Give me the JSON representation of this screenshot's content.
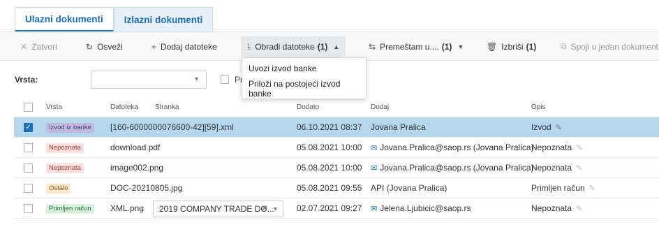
{
  "tabs": [
    {
      "label": "Ulazni dokumenti",
      "active": true
    },
    {
      "label": "Izlazni dokumenti",
      "active": false
    }
  ],
  "toolbar": {
    "close": {
      "icon": "close-icon",
      "label": "Zatvori"
    },
    "refresh": {
      "icon": "refresh-icon",
      "label": "Osveži"
    },
    "add": {
      "icon": "plus-icon",
      "label": "Dodaj datoteke"
    },
    "process": {
      "icon": "download-icon",
      "label": "Obradi datoteke",
      "count": "(1)"
    },
    "move": {
      "icon": "move-icon",
      "label": "Premeštam u....",
      "count": "(1)"
    },
    "delete": {
      "icon": "trash-icon",
      "label": "Izbriši",
      "count": "(1)"
    },
    "merge": {
      "icon": "merge-icon",
      "label": "Spoji u jedan dokument"
    }
  },
  "dropdown": {
    "items": [
      "Uvozi izvod banke",
      "Priloži na postojeći izvod banke"
    ]
  },
  "filter": {
    "label": "Vrsta:",
    "select_value": "",
    "checkbox_label": "Pr"
  },
  "table": {
    "headers": {
      "vrsta": "Vrsta",
      "datoteka": "Datoteka",
      "stranka": "Stranka",
      "dodato": "Dodato",
      "dodaj": "Dodaj",
      "opis": "Opis"
    },
    "rows": [
      {
        "selected": true,
        "vrsta": "Izvod iz banke",
        "badge": "izvod",
        "datoteka": "[160-6000000076600-42][59].xml",
        "stranka": "",
        "dodato": "06.10.2021 08:37",
        "dodaj": "Jovana Pralica",
        "mail": false,
        "opis": "Izvod"
      },
      {
        "selected": false,
        "vrsta": "Nepoznata",
        "badge": "nep",
        "datoteka": "download.pdf",
        "stranka": "",
        "dodato": "05.08.2021 10:00",
        "dodaj": "Jovana.Pralica@saop.rs (Jovana Pralica)",
        "mail": true,
        "opis": "Nepoznata"
      },
      {
        "selected": false,
        "vrsta": "Nepoznata",
        "badge": "nep",
        "datoteka": "image002.png",
        "stranka": "",
        "dodato": "05.08.2021 10:00",
        "dodaj": "Jovana.Pralica@saop.rs (Jovana Pralica)",
        "mail": true,
        "opis": "Nepoznata"
      },
      {
        "selected": false,
        "vrsta": "Ostalo",
        "badge": "ost",
        "datoteka": "DOC-20210805.jpg",
        "stranka": "",
        "dodato": "05.08.2021 09:55",
        "dodaj": "API (Jovana Pralica)",
        "mail": false,
        "opis": "Primljen račun"
      },
      {
        "selected": false,
        "vrsta": "Primljen račun",
        "badge": "prim",
        "datoteka": "XML.png",
        "stranka": "2019 COMPANY TRADE DO...",
        "dodato": "02.07.2021 09:27",
        "dodaj": "Jelena.Ljubicic@saop.rs",
        "mail": true,
        "opis": "Nepoznata"
      }
    ]
  },
  "colors": {
    "accent": "#1e6eb5",
    "selected_row": "#b4d7ef",
    "toolbar_bg": "#f6f7f8"
  }
}
